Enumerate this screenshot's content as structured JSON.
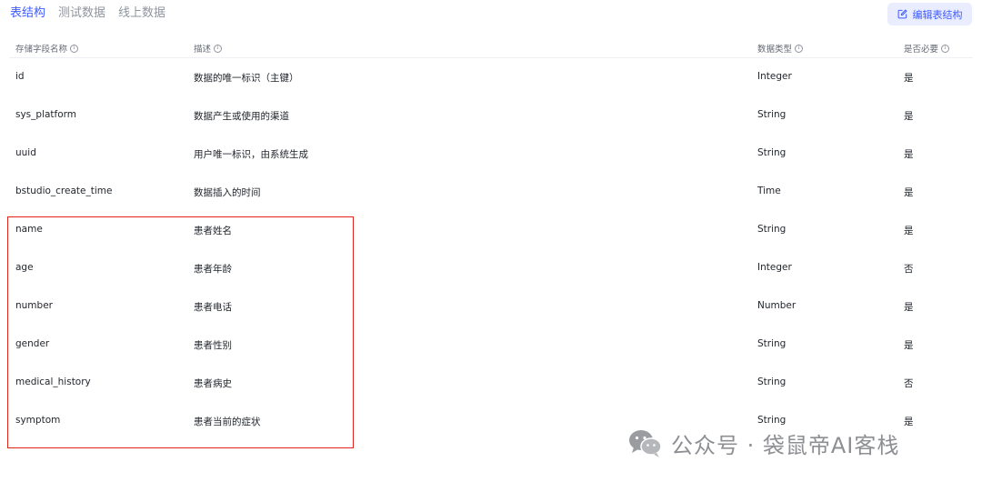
{
  "tabs": [
    {
      "label": "表结构",
      "active": true
    },
    {
      "label": "测试数据",
      "active": false
    },
    {
      "label": "线上数据",
      "active": false
    }
  ],
  "edit_button": {
    "label": "编辑表结构",
    "icon": "edit-icon"
  },
  "columns": [
    {
      "label": "存储字段名称",
      "info_icon": "ⓘ"
    },
    {
      "label": "描述",
      "info_icon": "ⓘ"
    },
    {
      "label": "数据类型",
      "info_icon": "ⓘ"
    },
    {
      "label": "是否必要",
      "info_icon": "ⓘ"
    }
  ],
  "rows": [
    {
      "name": "id",
      "desc": "数据的唯一标识（主键）",
      "type": "Integer",
      "required": "是"
    },
    {
      "name": "sys_platform",
      "desc": "数据产生或使用的渠道",
      "type": "String",
      "required": "是"
    },
    {
      "name": "uuid",
      "desc": "用户唯一标识，由系统生成",
      "type": "String",
      "required": "是"
    },
    {
      "name": "bstudio_create_time",
      "desc": "数据插入的时间",
      "type": "Time",
      "required": "是"
    },
    {
      "name": "name",
      "desc": "患者姓名",
      "type": "String",
      "required": "是"
    },
    {
      "name": "age",
      "desc": "患者年龄",
      "type": "Integer",
      "required": "否"
    },
    {
      "name": "number",
      "desc": "患者电话",
      "type": "Number",
      "required": "是"
    },
    {
      "name": "gender",
      "desc": "患者性别",
      "type": "String",
      "required": "是"
    },
    {
      "name": "medical_history",
      "desc": "患者病史",
      "type": "String",
      "required": "否"
    },
    {
      "name": "symptom",
      "desc": "患者当前的症状",
      "type": "String",
      "required": "是"
    }
  ],
  "watermark": {
    "text": "公众号 · 袋鼠帝AI客栈",
    "icon": "wechat-icon"
  },
  "colors": {
    "accent": "#3f5bff",
    "accent_bg": "#eaedff",
    "highlight": "#e2231a"
  }
}
